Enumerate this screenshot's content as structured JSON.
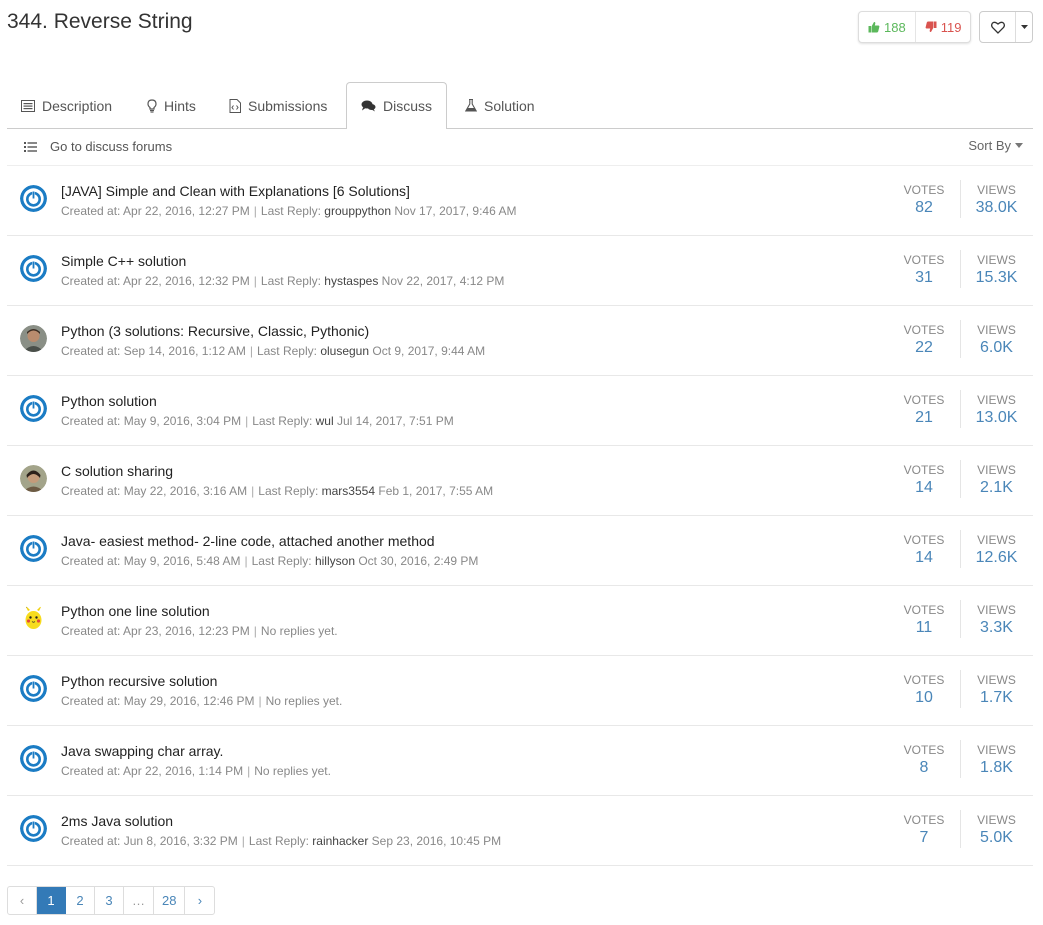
{
  "problem": {
    "title": "344. Reverse String",
    "upvotes": "188",
    "downvotes": "119"
  },
  "colors": {
    "accent": "#337ab7",
    "link": "#4a86b8",
    "upvote": "#5cb85c",
    "downvote": "#d9534f"
  },
  "tabs": [
    {
      "label": "Description",
      "icon": "list-icon"
    },
    {
      "label": "Hints",
      "icon": "lightbulb-icon"
    },
    {
      "label": "Submissions",
      "icon": "code-file-icon"
    },
    {
      "label": "Discuss",
      "icon": "comments-icon",
      "active": true
    },
    {
      "label": "Solution",
      "icon": "flask-icon"
    }
  ],
  "toolbar": {
    "goto_label": "Go to discuss forums",
    "sort_label": "Sort By"
  },
  "labels": {
    "created_at": "Created at:",
    "last_reply": "Last Reply:",
    "no_replies": "No replies yet.",
    "votes": "VOTES",
    "views": "VIEWS"
  },
  "topics": [
    {
      "title": "[JAVA] Simple and Clean with Explanations [6 Solutions]",
      "created": "Apr 22, 2016, 12:27 PM",
      "reply_user": "grouppython",
      "reply_time": "Nov 17, 2017, 9:46 AM",
      "votes": "82",
      "views": "38.0K",
      "avatar": "default"
    },
    {
      "title": "Simple C++ solution",
      "created": "Apr 22, 2016, 12:32 PM",
      "reply_user": "hystaspes",
      "reply_time": "Nov 22, 2017, 4:12 PM",
      "votes": "31",
      "views": "15.3K",
      "avatar": "default"
    },
    {
      "title": "Python (3 solutions: Recursive, Classic, Pythonic)",
      "created": "Sep 14, 2016, 1:12 AM",
      "reply_user": "olusegun",
      "reply_time": "Oct 9, 2017, 9:44 AM",
      "votes": "22",
      "views": "6.0K",
      "avatar": "photo1"
    },
    {
      "title": "Python solution",
      "created": "May 9, 2016, 3:04 PM",
      "reply_user": "wul",
      "reply_time": "Jul 14, 2017, 7:51 PM",
      "votes": "21",
      "views": "13.0K",
      "avatar": "default"
    },
    {
      "title": "C solution sharing",
      "created": "May 22, 2016, 3:16 AM",
      "reply_user": "mars3554",
      "reply_time": "Feb 1, 2017, 7:55 AM",
      "votes": "14",
      "views": "2.1K",
      "avatar": "photo2"
    },
    {
      "title": "Java- easiest method- 2-line code, attached another method",
      "created": "May 9, 2016, 5:48 AM",
      "reply_user": "hillyson",
      "reply_time": "Oct 30, 2016, 2:49 PM",
      "votes": "14",
      "views": "12.6K",
      "avatar": "default"
    },
    {
      "title": "Python one line solution",
      "created": "Apr 23, 2016, 12:23 PM",
      "reply_user": null,
      "reply_time": null,
      "votes": "11",
      "views": "3.3K",
      "avatar": "pikachu"
    },
    {
      "title": "Python recursive solution",
      "created": "May 29, 2016, 12:46 PM",
      "reply_user": null,
      "reply_time": null,
      "votes": "10",
      "views": "1.7K",
      "avatar": "default"
    },
    {
      "title": "Java swapping char array.",
      "created": "Apr 22, 2016, 1:14 PM",
      "reply_user": null,
      "reply_time": null,
      "votes": "8",
      "views": "1.8K",
      "avatar": "default"
    },
    {
      "title": "2ms Java solution",
      "created": "Jun 8, 2016, 3:32 PM",
      "reply_user": "rainhacker",
      "reply_time": "Sep 23, 2016, 10:45 PM",
      "votes": "7",
      "views": "5.0K",
      "avatar": "default"
    }
  ],
  "pagination": {
    "prev": "‹",
    "pages": [
      "1",
      "2",
      "3",
      "…",
      "28"
    ],
    "active": "1",
    "next": "›"
  }
}
